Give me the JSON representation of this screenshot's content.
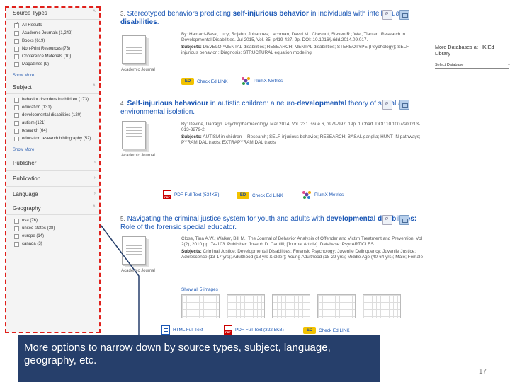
{
  "sidebar": {
    "source_types": {
      "heading": "Source Types",
      "options": [
        {
          "label": "All Results",
          "checked": true
        },
        {
          "label": "Academic Journals (1,242)",
          "checked": false
        },
        {
          "label": "Books (619)",
          "checked": false
        },
        {
          "label": "Non-Print Resources (73)",
          "checked": false
        },
        {
          "label": "Conference Materials (10)",
          "checked": false
        },
        {
          "label": "Magazines (9)",
          "checked": false
        }
      ],
      "show_more": "Show More"
    },
    "subject": {
      "heading": "Subject",
      "options": [
        {
          "label": "behavior disorders in children (173)",
          "checked": false
        },
        {
          "label": "education (131)",
          "checked": false
        },
        {
          "label": "developmental disabilities (120)",
          "checked": false
        },
        {
          "label": "autism (121)",
          "checked": false
        },
        {
          "label": "research (64)",
          "checked": false
        },
        {
          "label": "education research bibliography (52)",
          "checked": false
        }
      ],
      "show_more": "Show More"
    },
    "publisher": "Publisher",
    "publication": "Publication",
    "language": "Language",
    "geography": {
      "heading": "Geography",
      "options": [
        {
          "label": "usa (76)",
          "checked": false
        },
        {
          "label": "united states (38)",
          "checked": false
        },
        {
          "label": "europe (14)",
          "checked": false
        },
        {
          "label": "canada (3)",
          "checked": false
        }
      ]
    }
  },
  "results": [
    {
      "number": "3.",
      "title_a": "Stereotyped behaviors predicting ",
      "title_b": "self-injurious behavior",
      "title_c": " in individuals with intellectual ",
      "title_d": "disabilities",
      "title_e": ".",
      "authors": "By: Hamard-Besk, Lucy; Rojahn, Johannes; Lachman, David M.; Chesnut, Steven R.; Wei, Tianlan. Research in Developmental Disabilities. Jul 2015, Vol. 35, p419-427. 9p. DOI: 10.1016/j.ridd.2014.09.017.",
      "subjects_label": "Subjects:",
      "subjects": "DEVELOPMENTAL disabilities; RESEARCH; MENTAL disabilities; STEREOTYPE (Psychology); SELF-injurious behavior ; Diagnosis; STRUCTURAL equation modeling",
      "doc_type": "Academic Journal",
      "actions": {
        "edlink": "Check Ed LINK",
        "plumx": "PlumX Metrics"
      }
    },
    {
      "number": "4.",
      "title_a": "Self-injurious behaviour",
      "title_b": " in autistic children: a neuro-",
      "title_c": "developmental",
      "title_d": " theory of social and environmental isolation.",
      "authors": "By: Devine, Darragh. Psychopharmacology. Mar 2014, Vol. 231 Issue 6, p979-997. 19p. 1 Chart. DOI: 10.1007/s00213-013-3279-2.",
      "subjects_label": "Subjects:",
      "subjects": "AUTISM in children -- Research; SELF-injurious behavior; RESEARCH; BASAL ganglia; HUNT-IN pathways; PYRAMIDAL tracts; EXTRAPYRAMIDAL tracts",
      "doc_type": "Academic Journal",
      "actions": {
        "pdf": "PDF Full Text (534KB)",
        "edlink": "Check Ed LINK",
        "plumx": "PlumX Metrics"
      }
    },
    {
      "number": "5.",
      "title_a": "Navigating the criminal justice system for youth and adults with ",
      "title_b": "developmental disabilities:",
      "title_c": " Role of the forensic special educator.",
      "authors": "Close, Tina A.W.; Walker, Bill M.; The Journal of Behavior Analysis of Offender and Victim Treatment and Prevention, Vol 2(2), 2010 pp. 74-103. Publisher: Joseph D. Cautilli; [Journal Article]. Database: PsycARTICLES",
      "subjects_label": "Subjects:",
      "subjects": "Criminal Justice; Developmental Disabilities; Forensic Psychology; Juvenile Delinquency; Juvenile Justice; Adolescence (13-17 yrs); Adulthood (18 yrs & older); Young Adulthood (18-29 yrs); Middle Age (40-64 yrs); Male; Female",
      "doc_type": "Academic Journal",
      "show_images": "Show all 5 images",
      "actions": {
        "html": "HTML Full Text",
        "pdf": "PDF Full Text (322.5KB)",
        "edlink": "Check Ed LINK"
      }
    }
  ],
  "right_panel": {
    "more_databases": "More Databases at HKIEd Library",
    "select_placeholder": "Select Database"
  },
  "callout": {
    "text": "More options to narrow down by source types, subject, language, geography, etc."
  },
  "page_number": "17",
  "colors": {
    "highlight_border": "#e0201b",
    "callout_bg": "#263f6b",
    "link": "#1b57b5"
  }
}
